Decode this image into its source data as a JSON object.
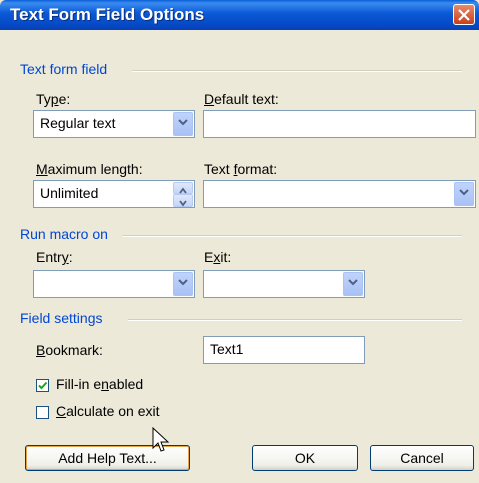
{
  "dialog": {
    "title": "Text Form Field Options"
  },
  "sections": {
    "text_form_field": "Text form field",
    "run_macro_on": "Run macro on",
    "field_settings": "Field settings"
  },
  "text_form_field": {
    "type_label": "Type:",
    "type_value": "Regular text",
    "default_text_label": "Default text:",
    "default_text_value": "",
    "max_length_label": "Maximum length:",
    "max_length_value": "Unlimited",
    "text_format_label": "Text format:",
    "text_format_value": ""
  },
  "run_macro": {
    "entry_label": "Entry:",
    "exit_label": "Exit:"
  },
  "field_settings": {
    "bookmark_label": "Bookmark:",
    "bookmark_value": "Text1",
    "fill_in_label": "Fill-in enabled",
    "fill_in_checked": true,
    "calculate_label": "Calculate on exit",
    "calculate_checked": false
  },
  "buttons": {
    "add_help": "Add Help Text...",
    "ok": "OK",
    "cancel": "Cancel"
  }
}
